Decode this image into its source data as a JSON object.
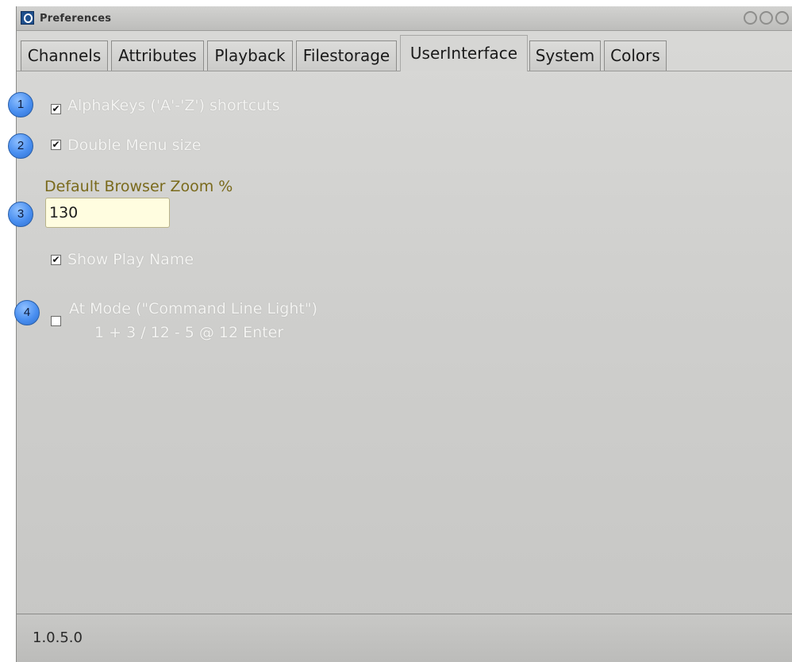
{
  "window": {
    "title": "Preferences"
  },
  "tabs": [
    {
      "label": "Channels"
    },
    {
      "label": "Attributes"
    },
    {
      "label": "Playback"
    },
    {
      "label": "Filestorage"
    },
    {
      "label": "UserInterface",
      "active": true
    },
    {
      "label": "System"
    },
    {
      "label": "Colors"
    }
  ],
  "options": {
    "alphakeys": {
      "label": "AlphaKeys ('A'-'Z') shortcuts",
      "checked": true
    },
    "double_menu": {
      "label": "Double Menu size",
      "checked": true
    },
    "zoom": {
      "label": "Default Browser Zoom %",
      "value": "130"
    },
    "show_play_name": {
      "label": "Show Play Name",
      "checked": true
    },
    "at_mode": {
      "label": "At Mode (\"Command Line Light\")",
      "example": "1 + 3 / 12 - 5 @ 12 Enter",
      "checked": false
    }
  },
  "callouts": [
    "1",
    "2",
    "3",
    "4"
  ],
  "status": {
    "version": "1.0.5.0"
  },
  "colors": {
    "panel": "#cfcfcd",
    "option_text": "#f4f4f2",
    "label_gold": "#7a6a1c",
    "input_bg": "#fffde0",
    "callout_blue": "#4a8ff0"
  },
  "icons": [
    "app-logo-icon",
    "checkmark-icon",
    "window-control-icon"
  ]
}
